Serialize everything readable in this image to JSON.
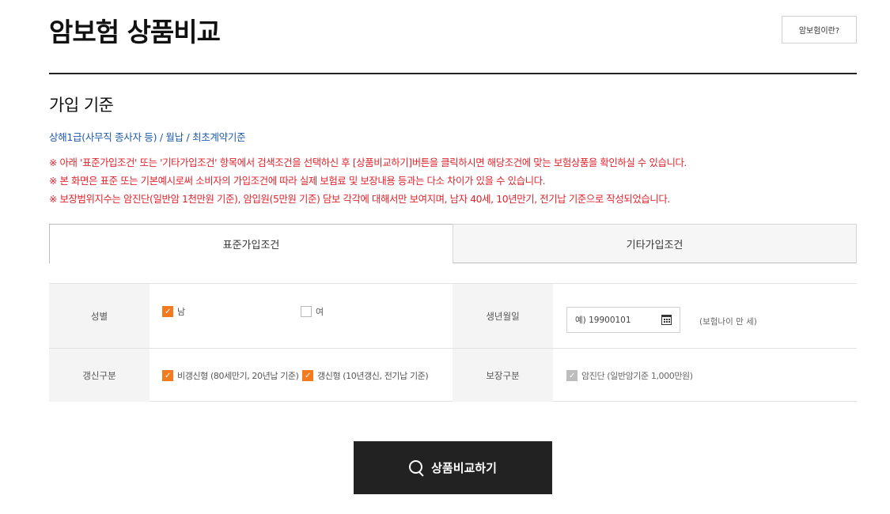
{
  "header": {
    "title": "암보험 상품비교",
    "about_button": "암보험이란?"
  },
  "criteria": {
    "heading": "가입 기준",
    "summary": "상해1급(사무직 종사자 등) / 월납 / 최초계약기준"
  },
  "notices": [
    "※ 아래 '표준가입조건' 또는 '기타가입조건' 항목에서 검색조건을 선택하신 후 [상품비교하기]버튼을 클릭하시면 해당조건에 맞는 보험상품을 확인하실 수 있습니다.",
    "※ 본 화면은 표준 또는 기본예시로써 소비자의 가입조건에 따라 실제 보험료 및 보장내용 등과는 다소 차이가 있을 수 있습니다.",
    "※ 보장범위지수는 암진단(일반암 1천만원 기준), 암입원(5만원 기준) 담보 각각에 대해서만 보여지며, 남자 40세, 10년만기, 전기납 기준으로 작성되었습니다."
  ],
  "tabs": [
    {
      "label": "표준가입조건",
      "active": true
    },
    {
      "label": "기타가입조건",
      "active": false
    }
  ],
  "form": {
    "gender": {
      "label": "성별",
      "options": [
        {
          "label": "남",
          "checked": true
        },
        {
          "label": "여",
          "checked": false
        }
      ]
    },
    "birth": {
      "label": "생년월일",
      "placeholder": "예) 19900101",
      "value": "",
      "age_text": "(보험나이 만     세)"
    },
    "renewal": {
      "label": "갱신구분",
      "options": [
        {
          "label": "비갱신형 (80세만기, 20년납 기준)",
          "checked": true
        },
        {
          "label": "갱신형 (10년갱신, 전기납 기준)",
          "checked": true
        }
      ]
    },
    "coverage": {
      "label": "보장구분",
      "options": [
        {
          "label": "암진단 (일반암기준 1,000만원)",
          "checked": true,
          "disabled": true
        }
      ]
    }
  },
  "actions": {
    "compare_button": "상품비교하기"
  },
  "colors": {
    "accent": "#f47a20",
    "notice": "#e0242d",
    "criteria": "#1e5aa8",
    "button_bg": "#222222"
  }
}
